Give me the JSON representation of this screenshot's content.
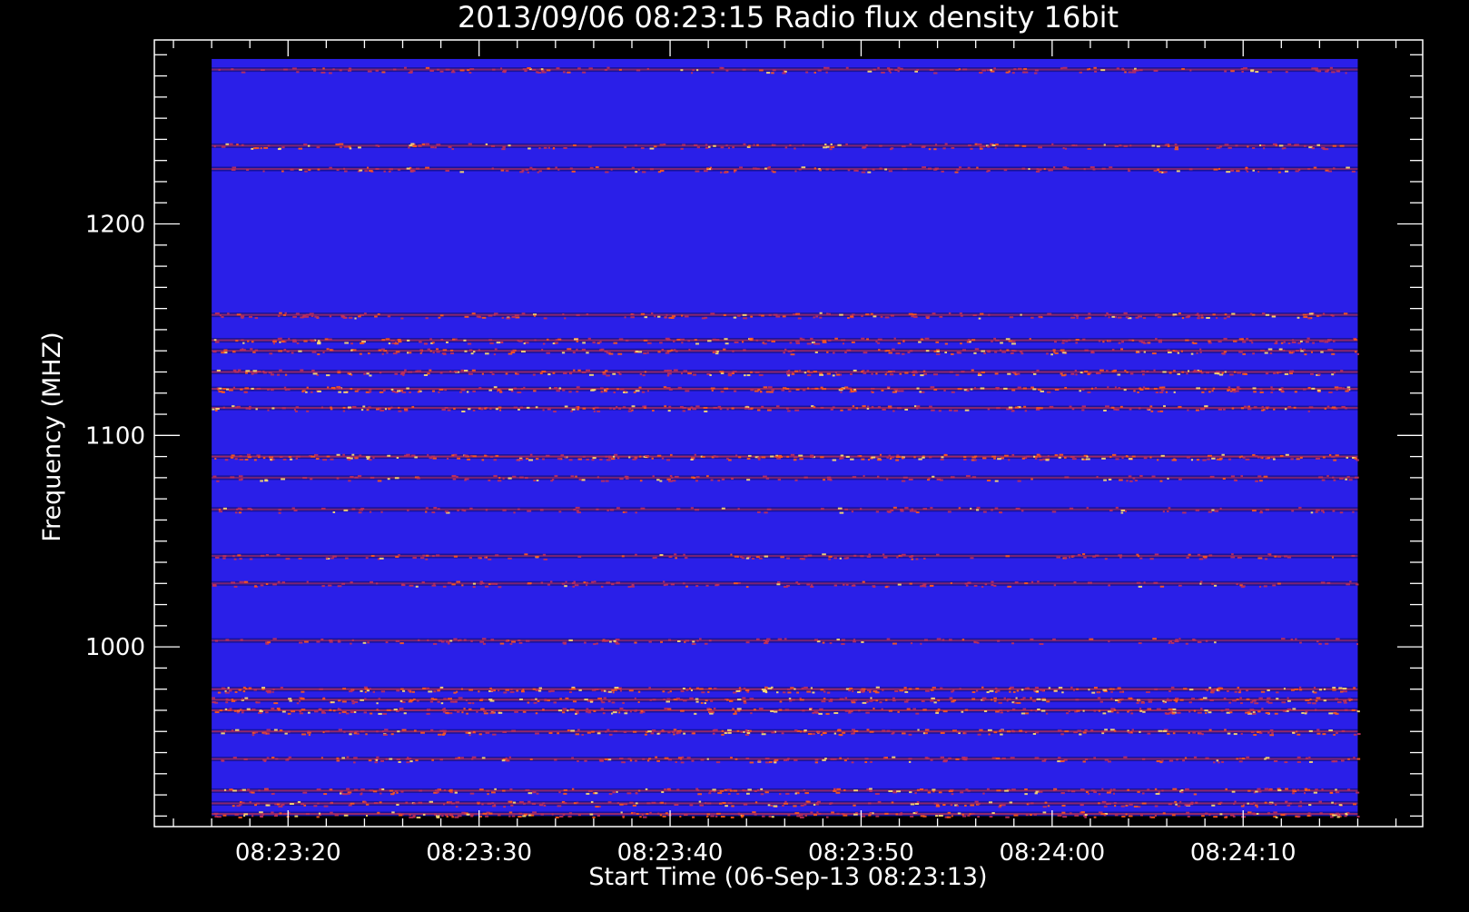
{
  "chart_data": {
    "type": "heatmap",
    "title": "2013/09/06 08:23:15 Radio flux density 16bit",
    "xlabel": "Start Time (06-Sep-13 08:23:13)",
    "ylabel": "Frequency (MHZ)",
    "x_ticks": [
      "08:23:20",
      "08:23:30",
      "08:23:40",
      "08:23:50",
      "08:24:00",
      "08:24:10"
    ],
    "x_tick_values": [
      20,
      30,
      40,
      50,
      60,
      70
    ],
    "xlim": [
      13,
      79.4
    ],
    "data_xlim": [
      16,
      76
    ],
    "y_ticks": [
      "1000",
      "1100",
      "1200"
    ],
    "y_tick_values": [
      1000,
      1100,
      1200
    ],
    "ylim": [
      915,
      1287
    ],
    "data_ylim": [
      920,
      1278
    ],
    "colors": {
      "background": "#000000",
      "axes": "#ffffff",
      "base_flux": "#2a1fe8",
      "dark_flux": "#0a0a5a",
      "mid_flux": "#c0305a",
      "high_flux": "#ff5a1a",
      "peak_flux": "#ffe070"
    },
    "bands": [
      {
        "freq": 1273,
        "intensity": 0.4
      },
      {
        "freq": 1237,
        "intensity": 0.45
      },
      {
        "freq": 1226,
        "intensity": 0.4
      },
      {
        "freq": 1157,
        "intensity": 0.55
      },
      {
        "freq": 1145,
        "intensity": 0.6
      },
      {
        "freq": 1140,
        "intensity": 0.55
      },
      {
        "freq": 1130,
        "intensity": 0.65
      },
      {
        "freq": 1122,
        "intensity": 0.75
      },
      {
        "freq": 1113,
        "intensity": 0.6
      },
      {
        "freq": 1090,
        "intensity": 0.85
      },
      {
        "freq": 1080,
        "intensity": 0.3
      },
      {
        "freq": 1065,
        "intensity": 0.25
      },
      {
        "freq": 1043,
        "intensity": 0.3
      },
      {
        "freq": 1030,
        "intensity": 0.35
      },
      {
        "freq": 1003,
        "intensity": 0.3
      },
      {
        "freq": 980,
        "intensity": 0.8
      },
      {
        "freq": 975,
        "intensity": 0.7
      },
      {
        "freq": 970,
        "intensity": 0.75
      },
      {
        "freq": 960,
        "intensity": 0.7
      },
      {
        "freq": 947,
        "intensity": 0.45
      },
      {
        "freq": 932,
        "intensity": 0.6
      },
      {
        "freq": 926,
        "intensity": 0.55
      },
      {
        "freq": 921,
        "intensity": 0.7
      }
    ]
  }
}
